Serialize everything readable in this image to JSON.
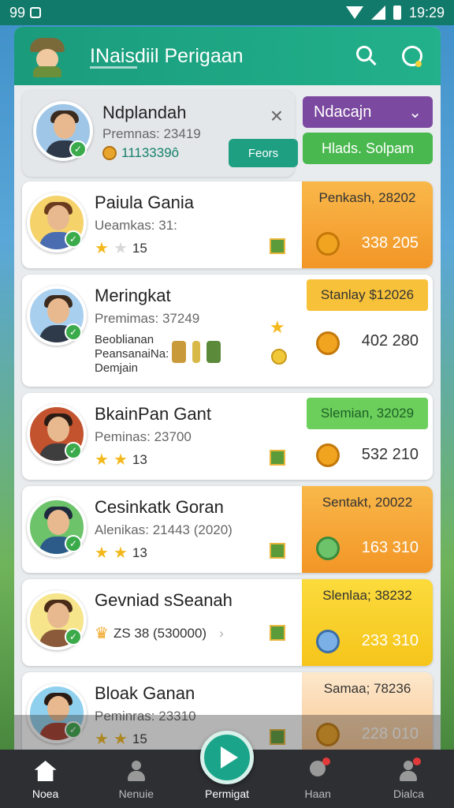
{
  "status_bar": {
    "left_text": "99",
    "time": "19:29"
  },
  "app": {
    "title": "INaisdiil Perigaan"
  },
  "featured": {
    "name": "Ndplandah",
    "premi": "Premnas: 23419",
    "score": "1113339ô",
    "button_label": "Feors",
    "dropdown_label": "Ndacajn",
    "green_button_label": "Hlads. Solpam"
  },
  "rows": [
    {
      "name": "Paiula Gania",
      "premi": "Ueamkas: 31:",
      "stars_value": "15",
      "reward_title": "Penkash, 28202",
      "reward_value": "338 205"
    },
    {
      "name": "Meringkat",
      "premi": "Premimas: 37249",
      "extra_line1": "Beoblianan",
      "extra_line2": "PeansanaiNa:",
      "extra_line3": "Demjain",
      "reward_title": "Stanlay $12026",
      "reward_value": "402 280"
    },
    {
      "name": "BkainPan Gant",
      "premi": "Peminas: 23700",
      "stars_value": "13",
      "reward_title": "Slemian, 32029",
      "reward_value": "532 210"
    },
    {
      "name": "Cesinkatk Goran",
      "premi": "Alenikas: 21443 (2020)",
      "stars_value": "13",
      "reward_title": "Sentakt, 20022",
      "reward_value": "163 310"
    },
    {
      "name": "Gevniad sSeanah",
      "premi": "ZS 38 (530000)",
      "reward_title": "Slenlaa; 38232",
      "reward_value": "233 310"
    },
    {
      "name": "Bloak Ganan",
      "premi": "Peminras: 23310",
      "stars_value": "15",
      "reward_title": "Samaa; 78236",
      "reward_value": "228 010"
    }
  ],
  "bottom_nav": {
    "home": "Noea",
    "profile": "Nenuie",
    "play": "Permigat",
    "chat": "Haan",
    "account": "Dialca"
  }
}
